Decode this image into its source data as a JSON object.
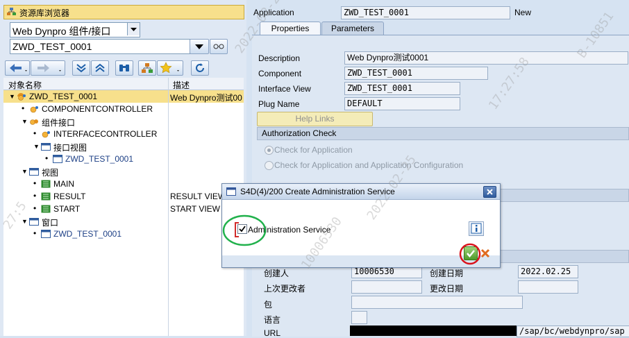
{
  "left": {
    "title": "资源库浏览器",
    "object_type": "Web Dynpro 组件/接口",
    "object_name": "ZWD_TEST_0001",
    "tree_headers": {
      "name": "对象名称",
      "desc": "描述"
    },
    "tree": [
      {
        "label": "ZWD_TEST_0001",
        "desc": "Web Dynpro测试00",
        "level": 0,
        "expand": "▼",
        "icon": "component-icon"
      },
      {
        "label": "COMPONENTCONTROLLER",
        "desc": "",
        "level": 1,
        "expand": "•",
        "icon": "controller-icon"
      },
      {
        "label": "组件接口",
        "desc": "",
        "level": 1,
        "expand": "▼",
        "icon": "interface-icon"
      },
      {
        "label": "INTERFACECONTROLLER",
        "desc": "",
        "level": 2,
        "expand": "•",
        "icon": "controller-icon"
      },
      {
        "label": "接口视图",
        "desc": "",
        "level": 2,
        "expand": "▼",
        "icon": "folder-icon"
      },
      {
        "label": "ZWD_TEST_0001",
        "desc": "",
        "level": 3,
        "expand": "•",
        "icon": "window-icon"
      },
      {
        "label": "视图",
        "desc": "",
        "level": 1,
        "expand": "▼",
        "icon": "folder-icon"
      },
      {
        "label": "MAIN",
        "desc": "",
        "level": 2,
        "expand": "•",
        "icon": "view-icon"
      },
      {
        "label": "RESULT",
        "desc": "RESULT VIEW",
        "level": 2,
        "expand": "•",
        "icon": "view-icon"
      },
      {
        "label": "START",
        "desc": "START VIEW",
        "level": 2,
        "expand": "•",
        "icon": "view-icon"
      },
      {
        "label": "窗口",
        "desc": "",
        "level": 1,
        "expand": "▼",
        "icon": "folder-icon"
      },
      {
        "label": "ZWD_TEST_0001",
        "desc": "",
        "level": 2,
        "expand": "•",
        "icon": "window-icon"
      }
    ]
  },
  "header": {
    "application_label": "Application",
    "application_value": "ZWD_TEST_0001",
    "status": "New"
  },
  "tabs": [
    "Properties",
    "Parameters"
  ],
  "properties": {
    "description_label": "Description",
    "description_value": "Web Dynpro测试0001",
    "component_label": "Component",
    "component_value": "ZWD_TEST_0001",
    "interface_view_label": "Interface View",
    "interface_view_value": "ZWD_TEST_0001",
    "plug_name_label": "Plug Name",
    "plug_name_value": "DEFAULT",
    "help_links": "Help Links"
  },
  "authorization": {
    "title": "Authorization Check",
    "option1": "Check for Application",
    "option2": "Check for Application and Application Configuration"
  },
  "admin": {
    "created_by_label": "创建人",
    "created_by_value": "10006530",
    "created_on_label": "创建日期",
    "created_on_value": "2022.02.25",
    "changed_by_label": "上次更改者",
    "changed_on_label": "更改日期",
    "package_label": "包",
    "language_label": "语言",
    "url_label": "URL",
    "url_value": "/sap/bc/webdynpro/sap"
  },
  "dialog": {
    "title": "S4D(4)/200 Create Administration Service",
    "checkbox_label": "Administration Service",
    "checked": true
  },
  "watermark": {
    "lines": [
      "2022-02-25",
      "17:27:58",
      "B-10851",
      "10006530",
      "27:5"
    ]
  }
}
